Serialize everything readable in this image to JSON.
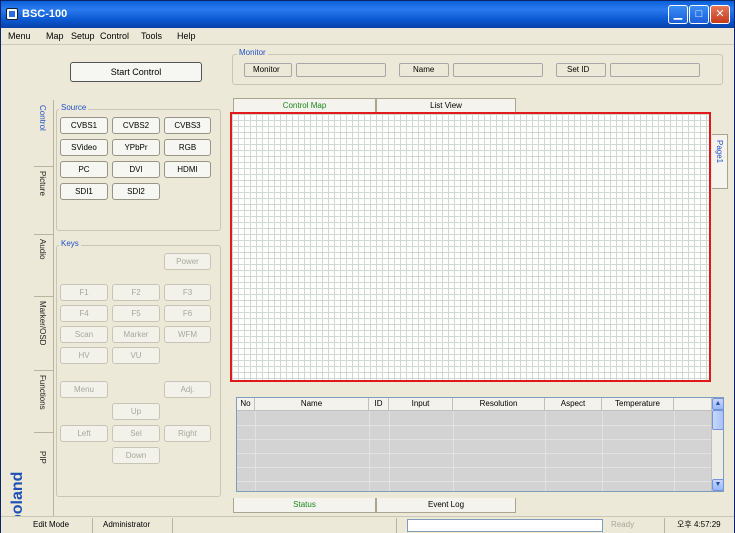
{
  "window": {
    "title": "BSC-100"
  },
  "menu": [
    "Menu",
    "Map",
    "Setup",
    "Control",
    "Tools",
    "Help"
  ],
  "toolbar": {
    "start_label": "Start Control"
  },
  "monitor": {
    "group_label": "Monitor",
    "monitor_label": "Monitor",
    "name_label": "Name",
    "setid_label": "Set ID"
  },
  "side_tabs": [
    "Control",
    "Picture",
    "Audio",
    "Marker/OSD",
    "Functions",
    "PIP"
  ],
  "source": {
    "label": "Source",
    "buttons": [
      "CVBS1",
      "CVBS2",
      "CVBS3",
      "SVideo",
      "YPbPr",
      "RGB",
      "PC",
      "DVI",
      "HDMI",
      "SDI1",
      "SDI2"
    ]
  },
  "keys": {
    "label": "Keys",
    "power": "Power",
    "buttons": [
      "F1",
      "F2",
      "F3",
      "F4",
      "F5",
      "F6",
      "Scan",
      "Marker",
      "WFM",
      "HV",
      "VU",
      "Menu",
      "Adj.",
      "Up",
      "Left",
      "Sel",
      "Right",
      "Down"
    ]
  },
  "map_tabs": [
    "Control Map",
    "List View"
  ],
  "page_tab": "Page1",
  "table": {
    "columns": [
      "No",
      "Name",
      "ID",
      "Input",
      "Resolution",
      "Aspect",
      "Temperature"
    ]
  },
  "bottom_tabs": [
    "Status",
    "Event Log"
  ],
  "status": {
    "mode": "Edit Mode",
    "user": "Administrator",
    "ready": "Ready",
    "time": "오후 4:57:29"
  },
  "brand": "boland",
  "colors": {
    "title_bar": "#0a58d0",
    "map_border": "#e01a1a",
    "group_label": "#2450c8",
    "active_tab": "#1a8a1a"
  }
}
